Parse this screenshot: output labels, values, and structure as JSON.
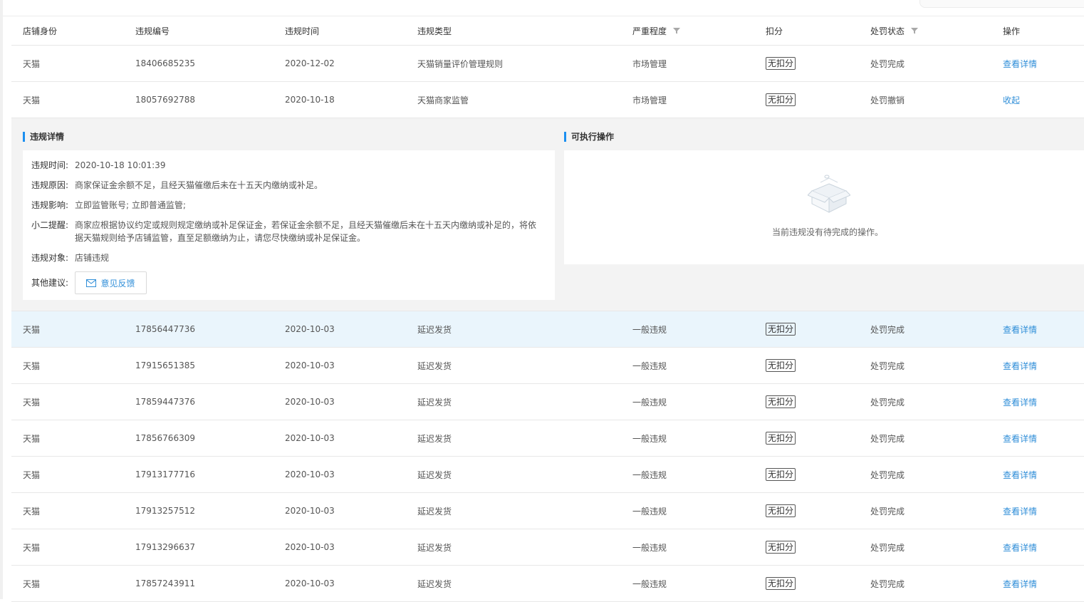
{
  "columns": [
    "店铺身份",
    "违规编号",
    "违规时间",
    "违规类型",
    "严重程度",
    "扣分",
    "处罚状态",
    "操作"
  ],
  "rows_top": [
    {
      "shop": "天猫",
      "id": "18406685235",
      "date": "2020-12-02",
      "type": "天猫销量评价管理规则",
      "severity": "市场管理",
      "points": "无扣分",
      "status": "处罚完成",
      "action": "查看详情"
    },
    {
      "shop": "天猫",
      "id": "18057692788",
      "date": "2020-10-18",
      "type": "天猫商家监管",
      "severity": "市场管理",
      "points": "无扣分",
      "status": "处罚撤销",
      "action": "收起"
    }
  ],
  "detail": {
    "title": "违规详情",
    "time_label": "违规时间:",
    "time_value": "2020-10-18 10:01:39",
    "reason_label": "违规原因:",
    "reason_value": "商家保证金余额不足，且经天猫催缴后未在十五天内缴纳或补足。",
    "impact_label": "违规影响:",
    "impact_value": "立即监管账号; 立即普通监管;",
    "tip_label": "小二提醒:",
    "tip_line1": "商家应根据协议约定或规则规定缴纳或补足保证金，若保证金余额不足，且经天猫催缴后未在十五天内缴纳或补足的，将依",
    "tip_line2": "据天猫规则给予店铺监管，直至足额缴纳为止，请您尽快缴纳或补足保证金。",
    "object_label": "违规对象:",
    "object_value": "店铺违规",
    "suggest_label": "其他建议:",
    "feedback_label": "意见反馈"
  },
  "operations": {
    "title": "可执行操作",
    "empty_text": "当前违规没有待完成的操作。"
  },
  "rows_bottom": [
    {
      "shop": "天猫",
      "id": "17856447736",
      "date": "2020-10-03",
      "type": "延迟发货",
      "severity": "一般违规",
      "points": "无扣分",
      "status": "处罚完成",
      "action": "查看详情"
    },
    {
      "shop": "天猫",
      "id": "17915651385",
      "date": "2020-10-03",
      "type": "延迟发货",
      "severity": "一般违规",
      "points": "无扣分",
      "status": "处罚完成",
      "action": "查看详情"
    },
    {
      "shop": "天猫",
      "id": "17859447376",
      "date": "2020-10-03",
      "type": "延迟发货",
      "severity": "一般违规",
      "points": "无扣分",
      "status": "处罚完成",
      "action": "查看详情"
    },
    {
      "shop": "天猫",
      "id": "17856766309",
      "date": "2020-10-03",
      "type": "延迟发货",
      "severity": "一般违规",
      "points": "无扣分",
      "status": "处罚完成",
      "action": "查看详情"
    },
    {
      "shop": "天猫",
      "id": "17913177716",
      "date": "2020-10-03",
      "type": "延迟发货",
      "severity": "一般违规",
      "points": "无扣分",
      "status": "处罚完成",
      "action": "查看详情"
    },
    {
      "shop": "天猫",
      "id": "17913257512",
      "date": "2020-10-03",
      "type": "延迟发货",
      "severity": "一般违规",
      "points": "无扣分",
      "status": "处罚完成",
      "action": "查看详情"
    },
    {
      "shop": "天猫",
      "id": "17913296637",
      "date": "2020-10-03",
      "type": "延迟发货",
      "severity": "一般违规",
      "points": "无扣分",
      "status": "处罚完成",
      "action": "查看详情"
    },
    {
      "shop": "天猫",
      "id": "17857243911",
      "date": "2020-10-03",
      "type": "延迟发货",
      "severity": "一般违规",
      "points": "无扣分",
      "status": "处罚完成",
      "action": "查看详情"
    }
  ],
  "colors": {
    "accent": "#2f8ed8",
    "highlight_row": "#eaf5fc",
    "title_bar": "#1b8ff0",
    "detail_bg": "#f3f3f3"
  },
  "icons": {
    "filter": "filter-icon",
    "mail": "mail-icon",
    "empty": "empty-box-icon"
  }
}
